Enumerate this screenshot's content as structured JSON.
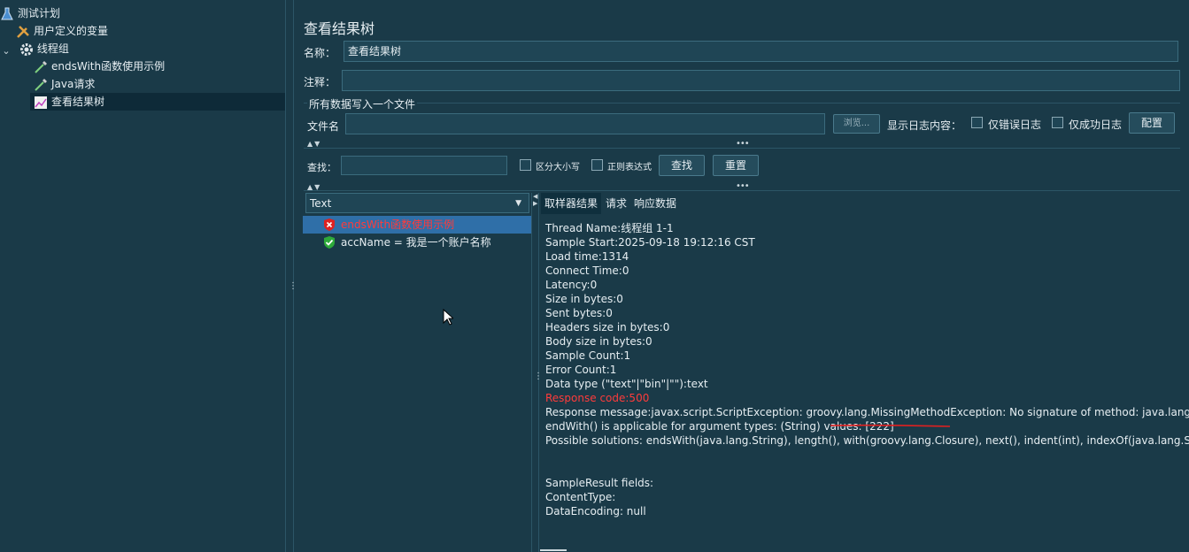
{
  "tree": {
    "items": [
      {
        "label": "测试计划",
        "icon": "flask-icon"
      },
      {
        "label": "用户定义的变量",
        "icon": "wrench-icon"
      },
      {
        "label": "线程组",
        "icon": "gear-icon"
      },
      {
        "label": "endsWith函数使用示例",
        "icon": "dropper-icon"
      },
      {
        "label": "Java请求",
        "icon": "dropper-icon"
      },
      {
        "label": "查看结果树",
        "icon": "chart-icon"
      }
    ],
    "toggle": "⌄"
  },
  "panel": {
    "title": "查看结果树",
    "name_label": "名称：",
    "name_value": "查看结果树",
    "comment_label": "注释：",
    "comment_value": "",
    "file_section_label": "所有数据写入一个文件",
    "file_label": "文件名",
    "file_value": "",
    "browse_label": "浏览...",
    "log_label": "显示日志内容：",
    "errors_only_label": "仅错误日志",
    "success_only_label": "仅成功日志",
    "config_label": "配置",
    "search_label": "查找：",
    "search_value": "",
    "case_label": "区分大小写",
    "regex_label": "正则表达式",
    "find_button": "查找",
    "reset_button": "重置",
    "renderer_value": "Text"
  },
  "results": [
    {
      "label": "endsWith函数使用示例",
      "status": "error"
    },
    {
      "label": "accName = 我是一个账户名称",
      "status": "success"
    }
  ],
  "tabs": [
    "取样器结果",
    "请求",
    "响应数据"
  ],
  "detail_lines": [
    {
      "text": "Thread Name:线程组 1-1",
      "err": false
    },
    {
      "text": "Sample Start:2025-09-18 19:12:16 CST",
      "err": false
    },
    {
      "text": "Load time:1314",
      "err": false
    },
    {
      "text": "Connect Time:0",
      "err": false
    },
    {
      "text": "Latency:0",
      "err": false
    },
    {
      "text": "Size in bytes:0",
      "err": false
    },
    {
      "text": "Sent bytes:0",
      "err": false
    },
    {
      "text": "Headers size in bytes:0",
      "err": false
    },
    {
      "text": "Body size in bytes:0",
      "err": false
    },
    {
      "text": "Sample Count:1",
      "err": false
    },
    {
      "text": "Error Count:1",
      "err": false
    },
    {
      "text": "Data type (\"text\"|\"bin\"|\"\"):text",
      "err": false
    },
    {
      "text": "Response code:500",
      "err": true
    },
    {
      "text": "Response message:javax.script.ScriptException: groovy.lang.MissingMethodException: No signature of method: java.lang.String.",
      "err": false
    },
    {
      "text": "endWith() is applicable for argument types: (String) values: [222]",
      "err": false
    },
    {
      "text": "Possible solutions: endsWith(java.lang.String), length(), with(groovy.lang.Closure), next(), indent(int), indexOf(java.lang.String)",
      "err": false
    },
    {
      "text": "",
      "err": false
    },
    {
      "text": "",
      "err": false
    },
    {
      "text": "SampleResult fields:",
      "err": false
    },
    {
      "text": "ContentType:",
      "err": false
    },
    {
      "text": "DataEncoding: null",
      "err": false
    }
  ],
  "colors": {
    "error": "#ff3b3b",
    "selected": "#2f6fa8",
    "background": "#1a3a48"
  }
}
